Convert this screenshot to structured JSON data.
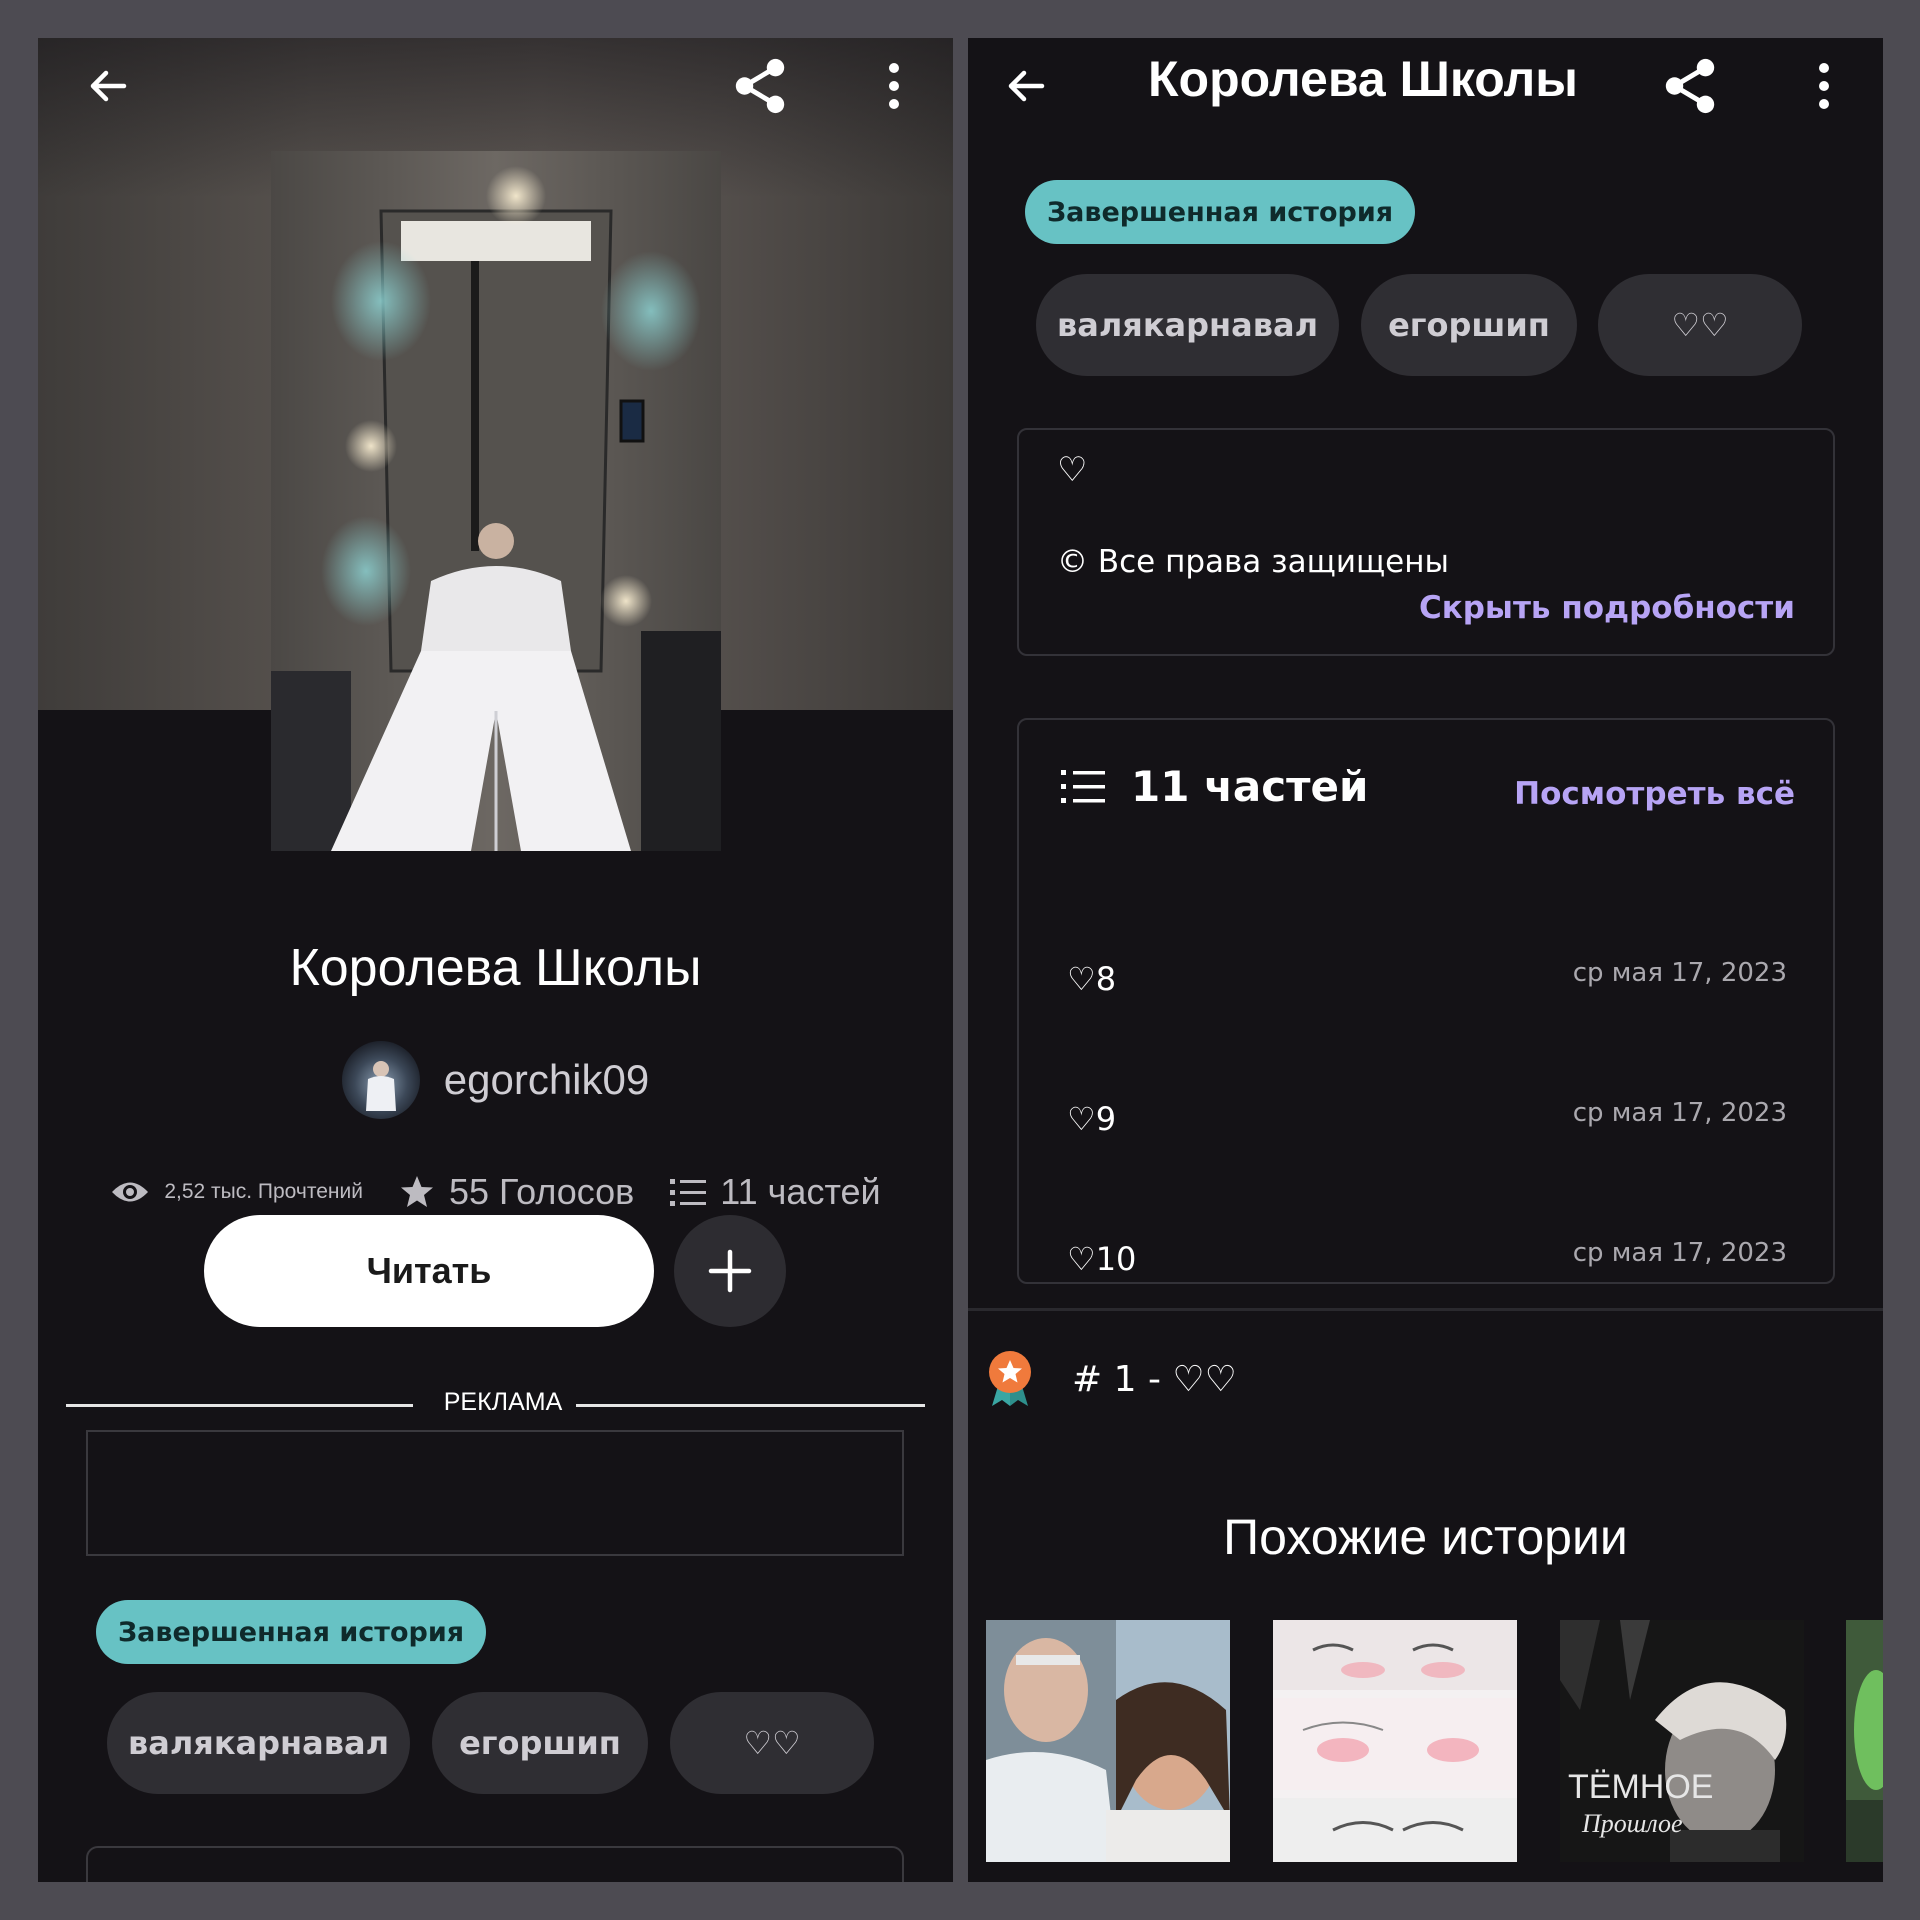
{
  "book": {
    "title": "Королева Школы",
    "author": "egorchik09",
    "reads": "2,52 тыс. Прочтений",
    "votes": "55 Голосов",
    "parts": "11 частей",
    "read_button": "Читать",
    "ad_label": "РЕКЛАМА",
    "status": "Завершенная история",
    "tags": [
      "валякарнавал",
      "егоршип",
      "♡♡"
    ]
  },
  "details": {
    "description_heart": "♡",
    "copyright": "© Все права защищены",
    "hide_link": "Скрыть подробности"
  },
  "parts_card": {
    "count_label": "11 частей",
    "see_all": "Посмотреть всё",
    "items": [
      {
        "title": "♡8",
        "date": "ср мая 17, 2023"
      },
      {
        "title": "♡9",
        "date": "ср мая 17, 2023"
      },
      {
        "title": "♡10",
        "date": "ср мая 17, 2023"
      }
    ]
  },
  "ranking": {
    "text": "# 1 - ♡♡"
  },
  "similar": {
    "heading": "Похожие истории",
    "covers": [
      {
        "caption": ""
      },
      {
        "caption": ""
      },
      {
        "caption_main": "ТЁМНОЕ",
        "caption_sub": "Прошлое"
      },
      {
        "caption": ""
      }
    ]
  },
  "colors": {
    "background": "#141216",
    "accent_purple": "#b7a4f5",
    "status_teal": "#67c2c4",
    "tag_bg": "#2f2e33"
  },
  "icons": {
    "back": "arrow-left-icon",
    "share": "share-icon",
    "menu": "more-vertical-icon",
    "views": "eye-icon",
    "votes": "star-icon",
    "parts": "list-icon",
    "add": "plus-icon",
    "rank": "medal-icon"
  }
}
